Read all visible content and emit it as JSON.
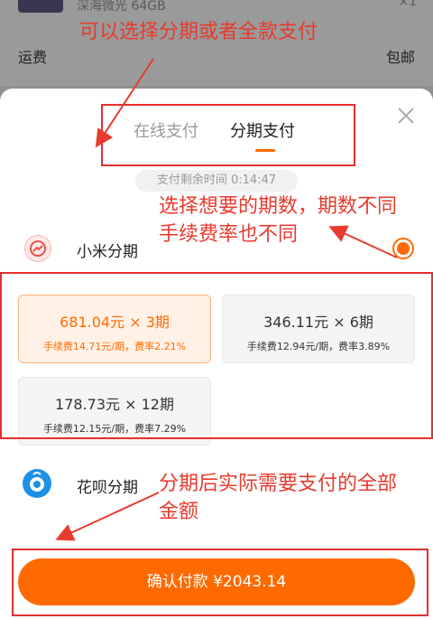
{
  "background": {
    "product_name": "深海微光 64GB",
    "product_right": "×1",
    "shipping_label": "运费",
    "shipping_value": "包邮"
  },
  "tabs": {
    "online": "在线支付",
    "installment": "分期支付"
  },
  "timer": "支付剩余时间 0:14:47",
  "methods": {
    "xiaomi": "小米分期",
    "huabei": "花呗分期"
  },
  "plans": [
    {
      "main": "681.04元 × 3期",
      "fee": "手续费14.71元/期，费率2.21%",
      "selected": true
    },
    {
      "main": "346.11元 × 6期",
      "fee": "手续费12.94元/期，费率3.89%",
      "selected": false
    },
    {
      "main": "178.73元 × 12期",
      "fee": "手续费12.15元/期，费率7.29%",
      "selected": false
    }
  ],
  "confirm_button": "确认付款 ¥2043.14",
  "annotations": {
    "top": "可以选择分期或者全款支付",
    "middle_line1": "选择想要的期数，期数不同",
    "middle_line2": "手续费率也不同",
    "bottom_line1": "分期后实际需要支付的全部",
    "bottom_line2": "金额"
  },
  "colors": {
    "accent": "#ff6a00",
    "annotation": "#e83a2e",
    "selected_card_bg": "#fff1e6"
  }
}
